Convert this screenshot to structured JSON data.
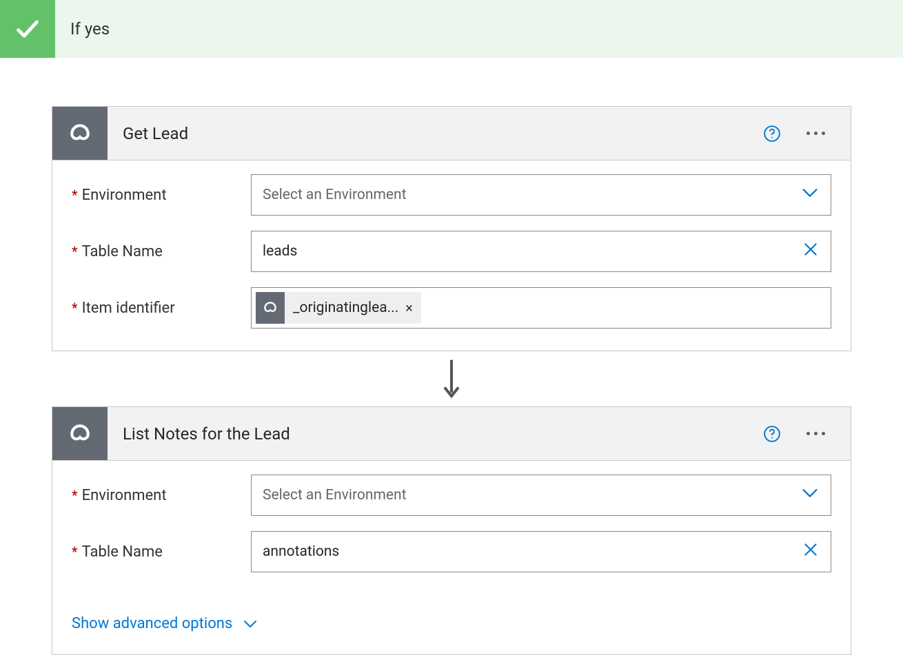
{
  "branch": {
    "title": "If yes"
  },
  "actions": {
    "getLead": {
      "title": "Get Lead",
      "fields": {
        "environment": {
          "label": "Environment",
          "placeholder": "Select an Environment"
        },
        "tableName": {
          "label": "Table Name",
          "value": "leads"
        },
        "itemId": {
          "label": "Item identifier",
          "token": "_originatinglea..."
        }
      }
    },
    "listNotes": {
      "title": "List Notes for the Lead",
      "fields": {
        "environment": {
          "label": "Environment",
          "placeholder": "Select an Environment"
        },
        "tableName": {
          "label": "Table Name",
          "value": "annotations"
        }
      },
      "advanced": "Show advanced options"
    }
  },
  "glyphs": {
    "remove_token": "×"
  }
}
